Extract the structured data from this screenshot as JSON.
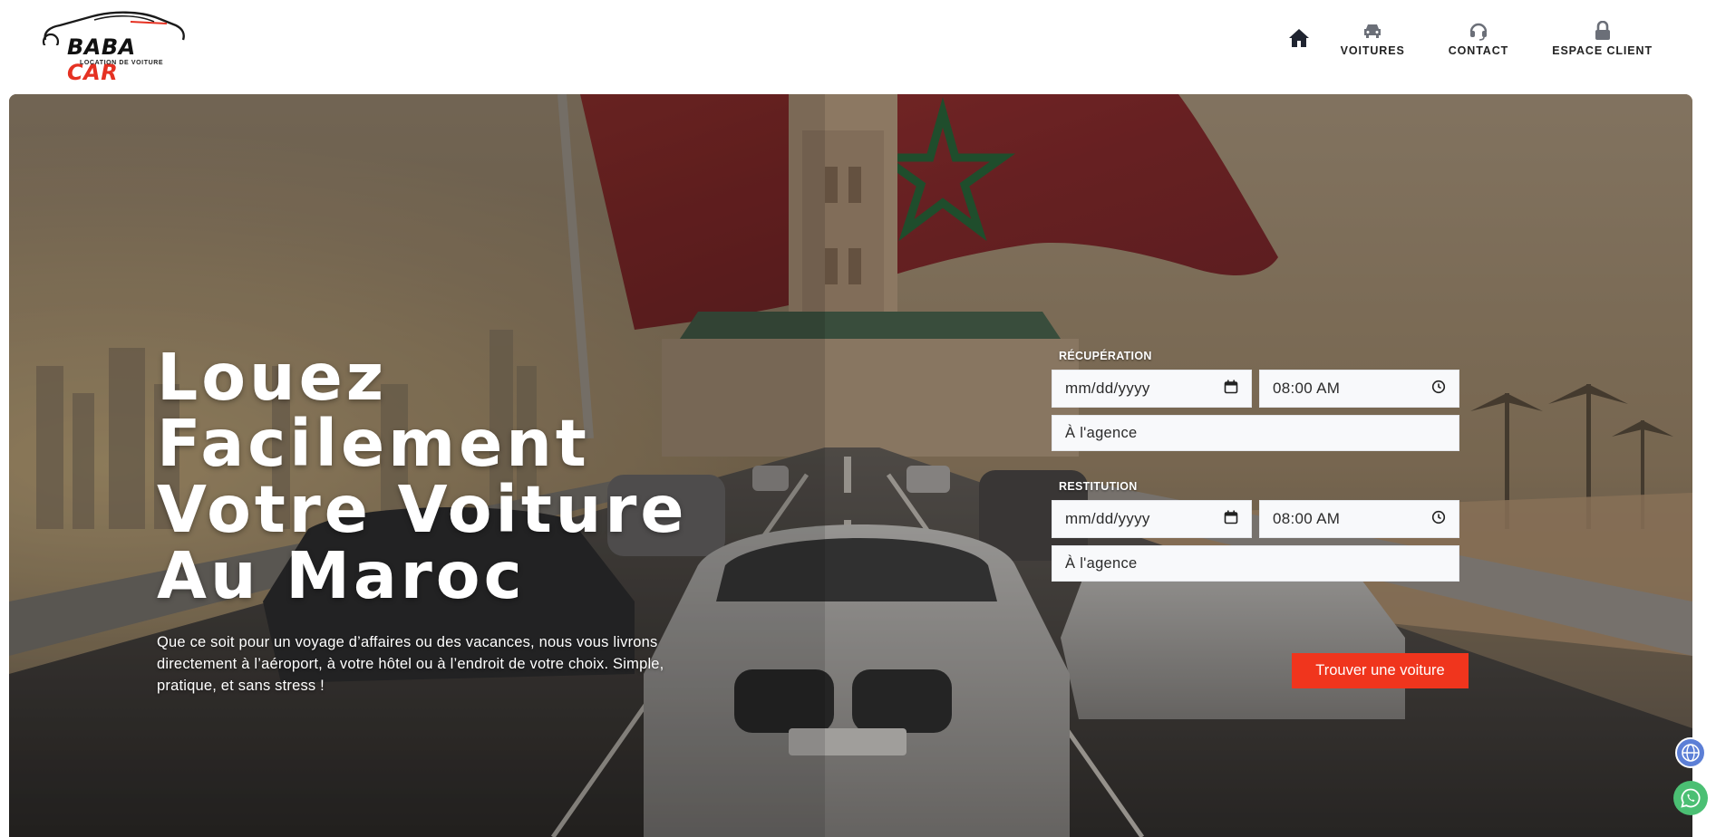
{
  "brand": {
    "name_part1": "BABA",
    "name_part2": "CAR",
    "tagline": "LOCATION DE VOITURE",
    "accent_color": "#e53122"
  },
  "nav": {
    "home_icon": "home-icon",
    "items": [
      {
        "label": "VOITURES",
        "icon": "car-icon"
      },
      {
        "label": "CONTACT",
        "icon": "headset-icon"
      },
      {
        "label": "ESPACE CLIENT",
        "icon": "lock-icon"
      }
    ]
  },
  "hero": {
    "title": "Louez Facilement Votre Voiture Au Maroc",
    "subtitle": "Que ce soit pour un voyage d’affaires ou des vacances, nous vous livrons directement à l’aéroport, à votre hôtel ou à l’endroit de votre choix. Simple, pratique, et sans stress !"
  },
  "booking": {
    "pickup": {
      "label": "RÉCUPÉRATION",
      "date_placeholder": "mm/dd/yyyy",
      "time_value": "08:00 AM",
      "location_value": "À l'agence"
    },
    "return": {
      "label": "RESTITUTION",
      "date_placeholder": "mm/dd/yyyy",
      "time_value": "08:00 AM",
      "location_value": "À l'agence"
    },
    "submit_label": "Trouver une voiture",
    "submit_color": "#f0351d"
  },
  "widgets": {
    "globe_icon": "globe-icon",
    "whatsapp_icon": "whatsapp-icon"
  }
}
